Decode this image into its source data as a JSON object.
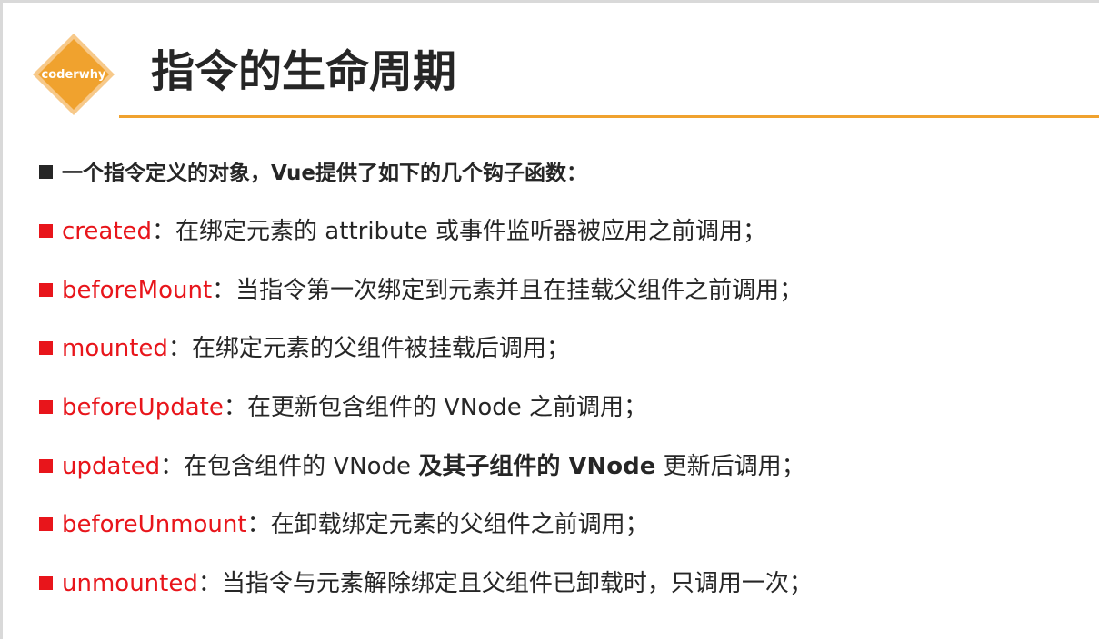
{
  "header": {
    "logo_text": "coderwhy",
    "title": "指令的生命周期"
  },
  "colors": {
    "accent": "#f0a22e",
    "logo_fill": "#f0a22e",
    "hook_name": "#e8151b",
    "text": "#262626"
  },
  "intro": {
    "text": "一个指令定义的对象，Vue提供了如下的几个钩子函数："
  },
  "hooks": [
    {
      "name": "created",
      "desc": "：在绑定元素的 attribute 或事件监听器被应用之前调用；"
    },
    {
      "name": "beforeMount",
      "desc": "：当指令第一次绑定到元素并且在挂载父组件之前调用；"
    },
    {
      "name": "mounted",
      "desc": "：在绑定元素的父组件被挂载后调用；"
    },
    {
      "name": "beforeUpdate",
      "desc": "：在更新包含组件的 VNode 之前调用；"
    },
    {
      "name": "updated",
      "desc": "：在包含组件的 VNode ",
      "desc_bold": "及其子组件的 VNode",
      "desc_tail": " 更新后调用；"
    },
    {
      "name": "beforeUnmount",
      "desc": "：在卸载绑定元素的父组件之前调用；"
    },
    {
      "name": "unmounted",
      "desc": "：当指令与元素解除绑定且父组件已卸载时，只调用一次；"
    }
  ]
}
